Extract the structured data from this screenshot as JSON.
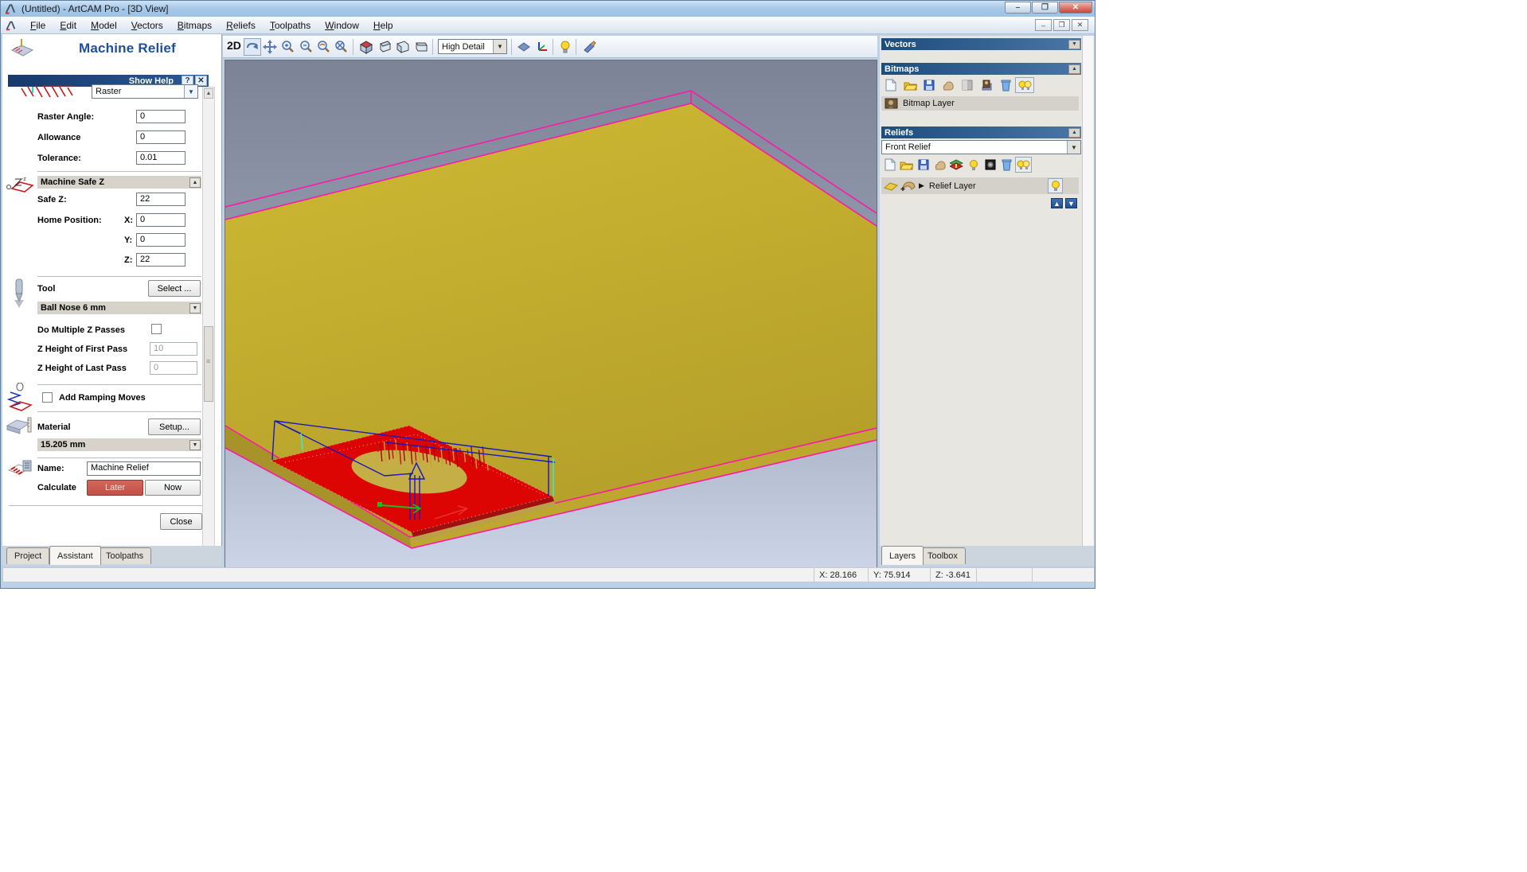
{
  "window": {
    "title": "(Untitled) - ArtCAM Pro - [3D View]",
    "minimize": "–",
    "restore": "❐",
    "close": "✕"
  },
  "menu": {
    "items": [
      "File",
      "Edit",
      "Model",
      "Vectors",
      "Bitmaps",
      "Reliefs",
      "Toolpaths",
      "Window",
      "Help"
    ],
    "child_min": "–",
    "child_restore": "❐",
    "child_close": "✕"
  },
  "toolbar": {
    "mode_2d": "2D",
    "detail_value": "High Detail"
  },
  "assistant": {
    "title": "Machine Relief",
    "show_help": "Show Help",
    "help_button": "?",
    "close_help_button": "✕",
    "strategy_value": "Raster",
    "raster_angle_label": "Raster Angle:",
    "raster_angle_value": "0",
    "allowance_label": "Allowance",
    "allowance_value": "0",
    "tolerance_label": "Tolerance:",
    "tolerance_value": "0.01",
    "safe_z_header": "Machine Safe Z",
    "safe_z_label": "Safe Z:",
    "safe_z_value": "22",
    "home_label": "Home Position:",
    "home_x_label": "X:",
    "home_x_value": "0",
    "home_y_label": "Y:",
    "home_y_value": "0",
    "home_z_label": "Z:",
    "home_z_value": "22",
    "tool_label": "Tool",
    "tool_select_button": "Select ...",
    "tool_name": "Ball Nose 6 mm",
    "multi_pass_label": "Do Multiple Z Passes",
    "first_pass_label": "Z Height of First Pass",
    "first_pass_value": "10",
    "last_pass_label": "Z Height of Last Pass",
    "last_pass_value": "0",
    "ramping_label": "Add Ramping Moves",
    "material_label": "Material",
    "material_setup_button": "Setup...",
    "material_thickness": "15.205 mm",
    "name_label": "Name:",
    "name_value": "Machine Relief",
    "calculate_label": "Calculate",
    "later_button": "Later",
    "now_button": "Now",
    "close_button": "Close",
    "tabs": [
      "Project",
      "Assistant",
      "Toolpaths"
    ],
    "active_tab": "Assistant"
  },
  "right_panel": {
    "vectors_header": "Vectors",
    "bitmaps_header": "Bitmaps",
    "bitmap_layer_label": "Bitmap Layer",
    "reliefs_header": "Reliefs",
    "relief_combo_value": "Front Relief",
    "relief_layer_label": "Relief Layer",
    "tabs": [
      "Layers",
      "Toolbox"
    ],
    "active_tab": "Layers"
  },
  "status_bar": {
    "x": "X: 28.166",
    "y": "Y: 75.914",
    "z": "Z: -3.641"
  },
  "colors": {
    "material_yellow": "#c8b232",
    "toolpath_red": "#dd0404",
    "outline_magenta": "#ff18a8",
    "wire_blue": "#1818c0",
    "header_blue": "#1d4d7c",
    "later_button_red": "#c85a50"
  }
}
